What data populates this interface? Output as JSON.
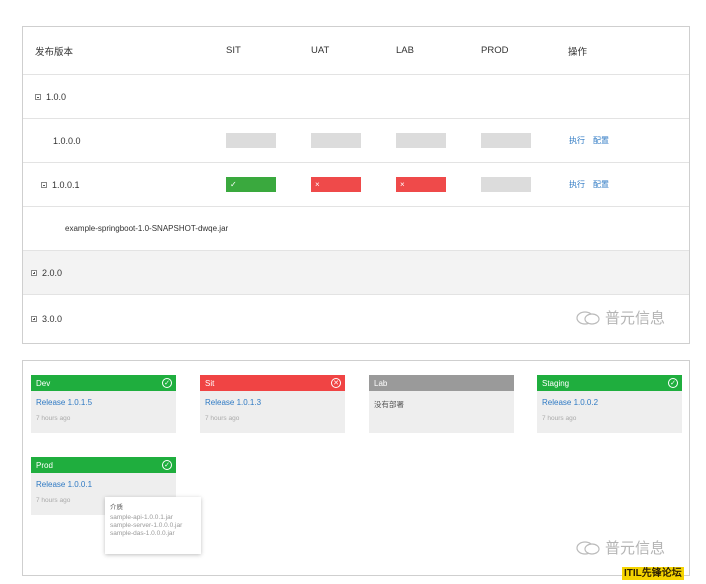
{
  "table": {
    "headers": [
      "发布版本",
      "SIT",
      "UAT",
      "LAB",
      "PROD",
      "操作"
    ],
    "rows": {
      "v100": "1.0.0",
      "v1000": "1.0.0.0",
      "v1001": "1.0.0.1",
      "jar": "example-springboot-1.0-SNAPSHOT-dwqe.jar",
      "v200": "2.0.0",
      "v300": "3.0.0"
    },
    "status_marks": {
      "ok": "✓",
      "fail": "×"
    },
    "actions": {
      "execute": "执行",
      "config": "配置"
    }
  },
  "watermark": "普元信息",
  "cards": [
    {
      "env": "Dev",
      "status": "ok",
      "release": "Release 1.0.1.5",
      "time": "7 hours ago"
    },
    {
      "env": "Sit",
      "status": "fail",
      "release": "Release 1.0.1.3",
      "time": "7 hours ago"
    },
    {
      "env": "Lab",
      "status": "none",
      "empty_text": "没有部署"
    },
    {
      "env": "Staging",
      "status": "ok",
      "release": "Release 1.0.0.2",
      "time": "7 hours ago"
    },
    {
      "env": "Prod",
      "status": "ok",
      "release": "Release 1.0.0.1",
      "time": "7 hours ago"
    }
  ],
  "icons": {
    "ok": "✓",
    "fail": "✕"
  },
  "tooltip": {
    "title": "介质",
    "items": [
      "sample-api-1.0.0.1.jar",
      "sample-server-1.0.0.0.jar",
      "sample-das-1.0.0.0.jar"
    ]
  },
  "forum_tag": "ITIL先锋论坛",
  "colors": {
    "green": "#1fae3e",
    "red": "#f04444",
    "gray": "#9a9a9a",
    "link": "#2f7ac4"
  }
}
